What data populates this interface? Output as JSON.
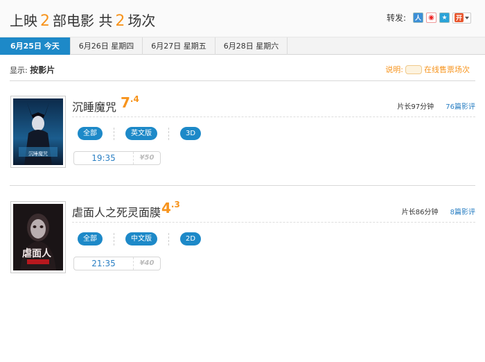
{
  "header": {
    "title_prefix": "上映",
    "movie_count": "2",
    "title_mid": "部电影 共",
    "session_count": "2",
    "title_suffix": "场次",
    "share_label": "转发:",
    "share_icons": [
      "renren-icon",
      "weibo-icon",
      "qzone-icon",
      "open-share-icon"
    ]
  },
  "tabs": [
    {
      "label": "6月25日  今天",
      "active": true
    },
    {
      "label": "6月26日  星期四",
      "active": false
    },
    {
      "label": "6月27日  星期五",
      "active": false
    },
    {
      "label": "6月28日  星期六",
      "active": false
    }
  ],
  "display": {
    "label": "显示:",
    "mode": "按影片"
  },
  "legend": {
    "prefix": "说明:",
    "text": "在线售票场次"
  },
  "movies": [
    {
      "title": "沉睡魔咒",
      "rating_int": "7",
      "rating_dec": ".4",
      "duration": "片长97分钟",
      "reviews": "76篇影评",
      "filters": [
        "全部",
        "英文版",
        "3D"
      ],
      "showtimes": [
        {
          "time": "19:35",
          "price": "¥50"
        }
      ]
    },
    {
      "title": "虐面人之死灵面膜",
      "rating_int": "4",
      "rating_dec": ".3",
      "duration": "片长86分钟",
      "reviews": "8篇影评",
      "filters": [
        "全部",
        "中文版",
        "2D"
      ],
      "showtimes": [
        {
          "time": "21:35",
          "price": "¥40"
        }
      ]
    }
  ]
}
